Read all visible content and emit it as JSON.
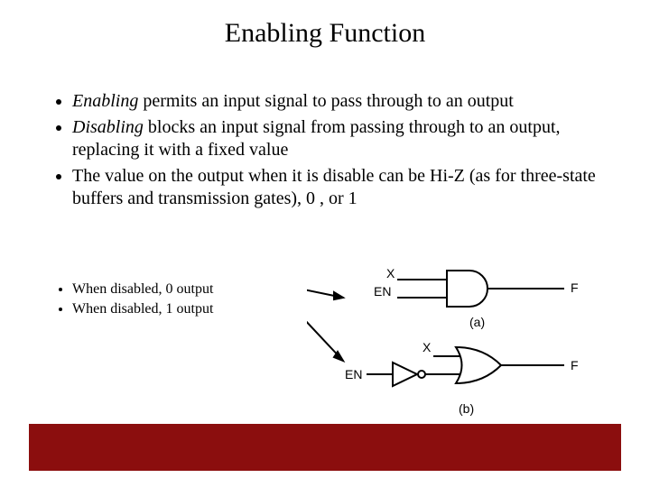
{
  "title": "Enabling Function",
  "bullets": {
    "b1": {
      "emph": "Enabling",
      "rest": " permits an input signal to pass through to an output"
    },
    "b2": {
      "emph": "Disabling",
      "rest": " blocks an input signal from passing through to an output, replacing it with a fixed value"
    },
    "b3": {
      "text": "The value on the output when it is disable can be Hi-Z (as for three-state buffers and transmission gates), 0 , or 1"
    }
  },
  "sub_bullets": {
    "s1": "When disabled, 0 output",
    "s2": "When disabled, 1 output"
  },
  "diagram": {
    "a": {
      "in1": "X",
      "in2": "EN",
      "out": "F",
      "label": "(a)"
    },
    "b": {
      "in1": "X",
      "in2": "EN",
      "out": "F",
      "label": "(b)"
    }
  }
}
